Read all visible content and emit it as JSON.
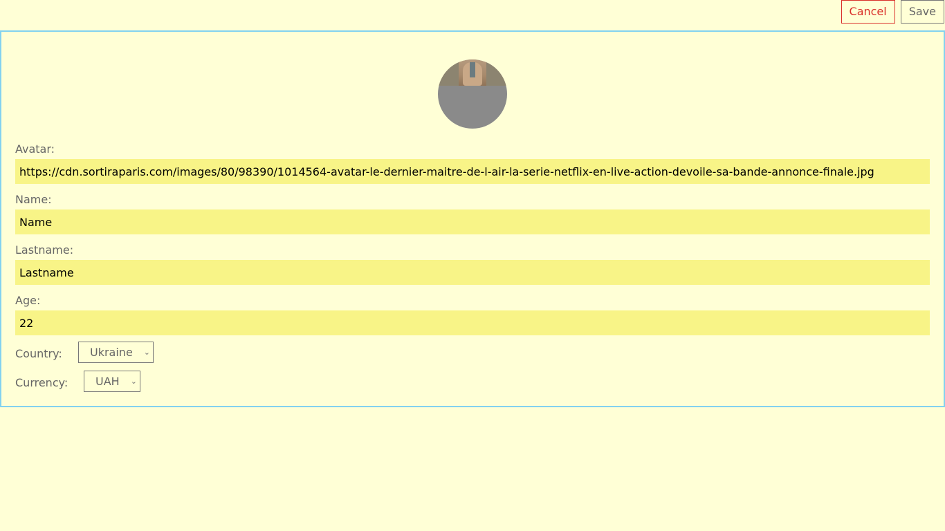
{
  "toolbar": {
    "cancel_label": "Cancel",
    "save_label": "Save"
  },
  "form": {
    "avatar": {
      "label": "Avatar:",
      "value": "https://cdn.sortiraparis.com/images/80/98390/1014564-avatar-le-dernier-maitre-de-l-air-la-serie-netflix-en-live-action-devoile-sa-bande-annonce-finale.jpg"
    },
    "name": {
      "label": "Name:",
      "value": "Name"
    },
    "lastname": {
      "label": "Lastname:",
      "value": "Lastname"
    },
    "age": {
      "label": "Age:",
      "value": "22"
    },
    "country": {
      "label": "Country:",
      "selected": "Ukraine"
    },
    "currency": {
      "label": "Currency:",
      "selected": "UAH"
    }
  },
  "colors": {
    "background": "#ffffd6",
    "input_background": "#f8f487",
    "panel_border": "#82d2f0",
    "cancel": "#d9302a"
  },
  "icons": {
    "dropdown": "chevron-down-icon"
  }
}
